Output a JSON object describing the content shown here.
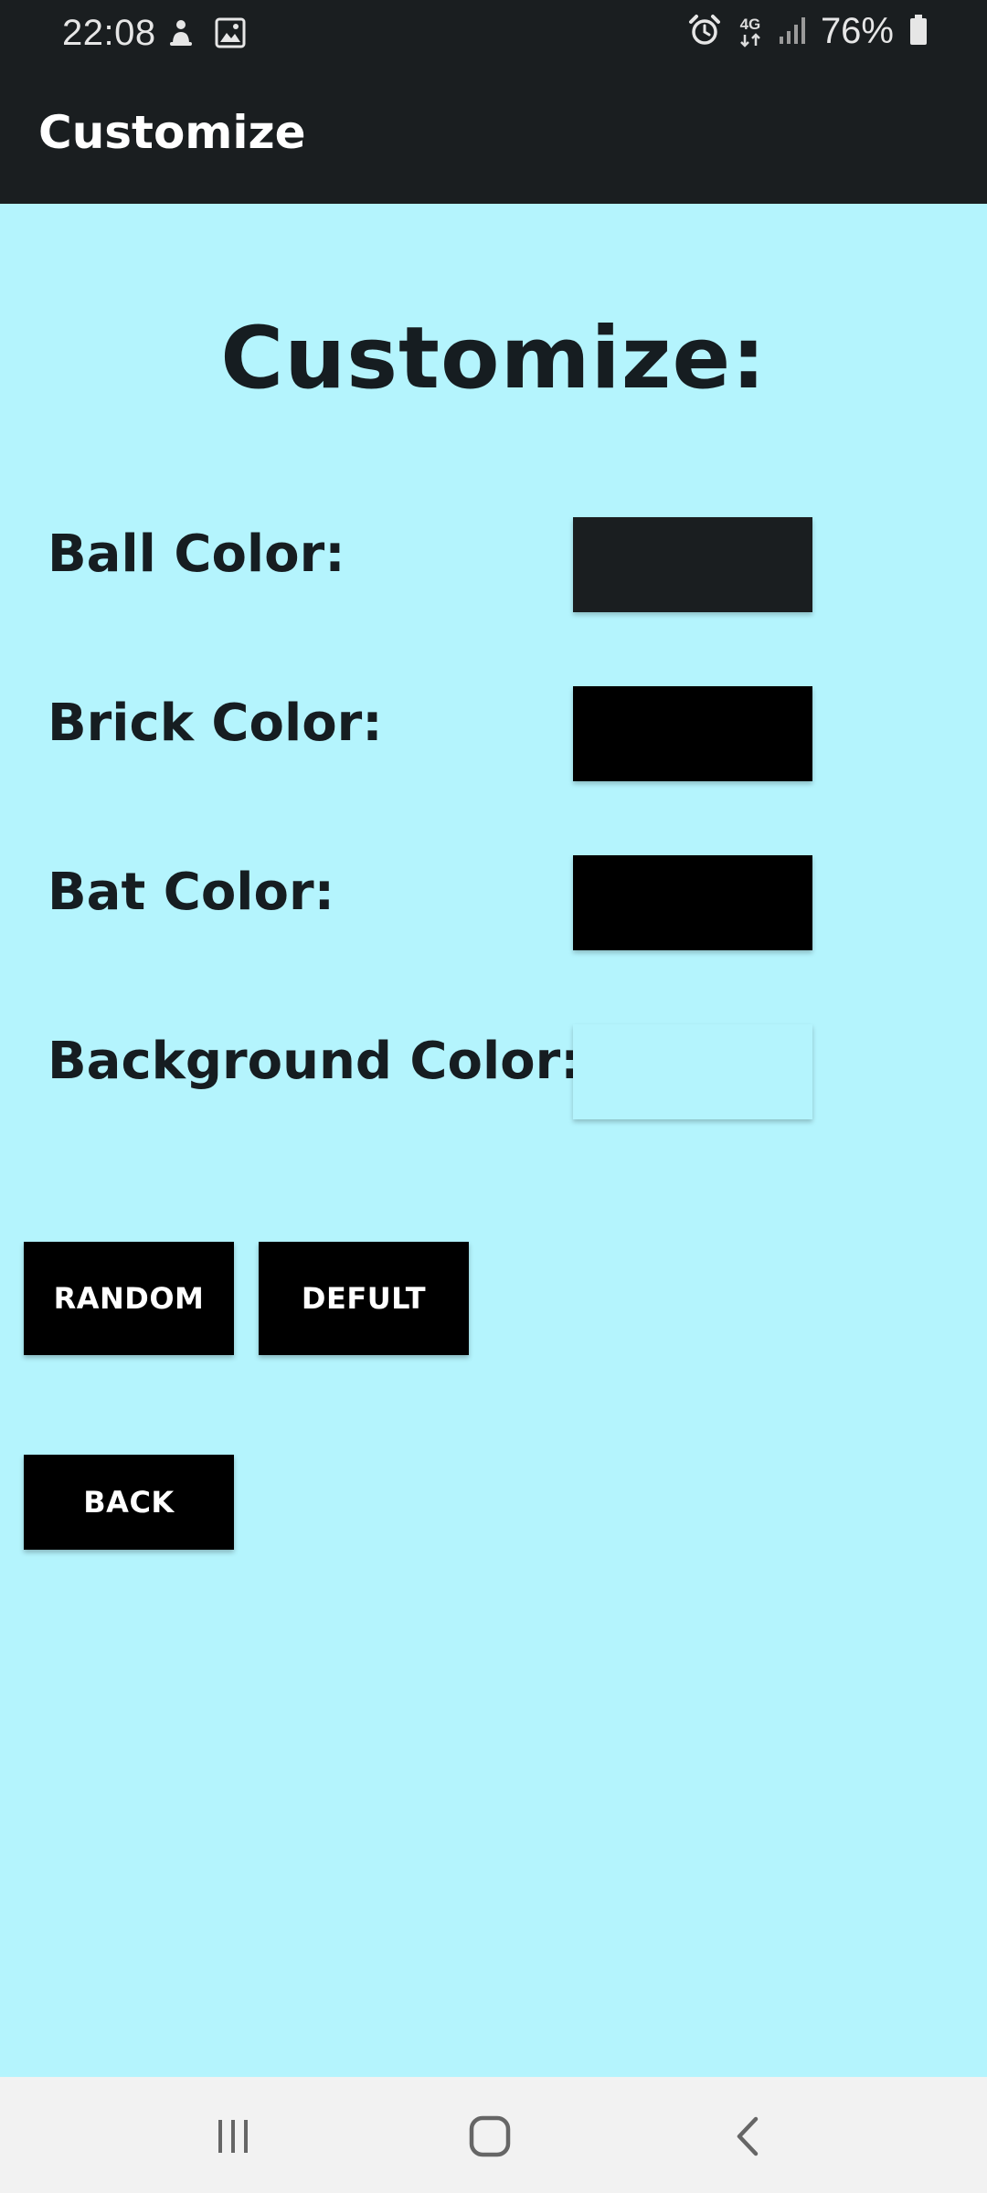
{
  "status_bar": {
    "time": "22:08",
    "network": "4G",
    "battery": "76%",
    "icons": [
      "download-manager-icon",
      "gallery-icon",
      "alarm-icon",
      "network-4g-icon",
      "signal-icon",
      "battery-icon"
    ]
  },
  "app_bar": {
    "title": "Customize"
  },
  "main": {
    "heading": "Customize:",
    "rows": [
      {
        "label": "Ball Color:",
        "swatch_color": "#1a1e20"
      },
      {
        "label": "Brick Color:",
        "swatch_color": "#000000"
      },
      {
        "label": "Bat Color:",
        "swatch_color": "#000000"
      },
      {
        "label": "Background Color:",
        "swatch_color": "#b4f4fd"
      }
    ],
    "buttons": {
      "random": "RANDOM",
      "default": "DEFULT",
      "back": "BACK"
    }
  },
  "nav_bar": {
    "icons": [
      "recent-apps-icon",
      "home-icon",
      "back-icon"
    ]
  },
  "colors": {
    "background": "#b4f4fd",
    "app_bar": "#1a1e20",
    "text": "#161d21",
    "button": "#000000",
    "nav_bar": "#f2f2f2"
  }
}
